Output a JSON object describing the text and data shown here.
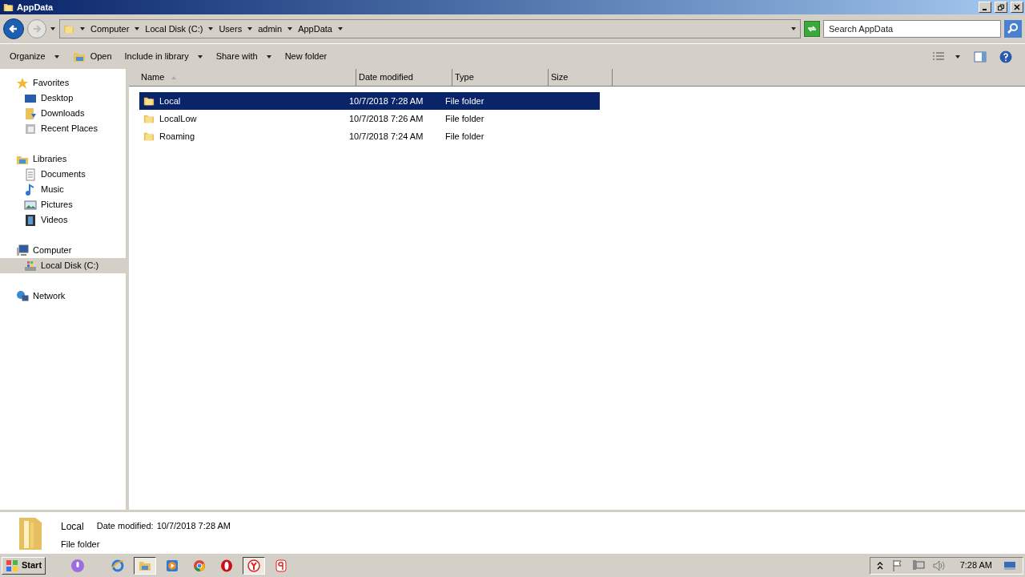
{
  "window": {
    "title": "AppData"
  },
  "address": {
    "crumbs": [
      "Computer",
      "Local Disk (C:)",
      "Users",
      "admin",
      "AppData"
    ],
    "search_placeholder": "Search AppData"
  },
  "toolbar": [
    {
      "label": "Organize",
      "kind": "menu"
    },
    {
      "label": "Open",
      "kind": "open"
    },
    {
      "label": "Include in library",
      "kind": "menu"
    },
    {
      "label": "Share with",
      "kind": "menu"
    },
    {
      "label": "New folder",
      "kind": "plain"
    }
  ],
  "sidebar": [
    {
      "label": "Favorites",
      "kind": "star",
      "selected": false,
      "children": [
        {
          "label": "Desktop",
          "kind": "desktop",
          "selected": false
        },
        {
          "label": "Downloads",
          "kind": "downloads",
          "selected": false
        },
        {
          "label": "Recent Places",
          "kind": "recent",
          "selected": false
        }
      ]
    },
    {
      "label": "Libraries",
      "kind": "library",
      "selected": false,
      "children": [
        {
          "label": "Documents",
          "kind": "document",
          "selected": false
        },
        {
          "label": "Music",
          "kind": "music",
          "selected": false
        },
        {
          "label": "Pictures",
          "kind": "pictures",
          "selected": false
        },
        {
          "label": "Videos",
          "kind": "videos",
          "selected": false
        }
      ]
    },
    {
      "label": "Computer",
      "kind": "computer",
      "selected": false,
      "children": [
        {
          "label": "Local Disk (C:)",
          "kind": "disk",
          "selected": true
        }
      ]
    },
    {
      "label": "Network",
      "kind": "network",
      "selected": false
    }
  ],
  "table": {
    "columns": [
      "Name",
      "Date modified",
      "Type",
      "Size"
    ],
    "rows": [
      {
        "name": "Local",
        "date": "10/7/2018 7:28 AM",
        "type": "File folder",
        "selected": true
      },
      {
        "name": "LocalLow",
        "date": "10/7/2018 7:26 AM",
        "type": "File folder",
        "selected": false
      },
      {
        "name": "Roaming",
        "date": "10/7/2018 7:24 AM",
        "type": "File folder",
        "selected": false
      }
    ]
  },
  "details": {
    "name": "Local",
    "date_label": "Date modified:",
    "date": "10/7/2018 7:28 AM",
    "type": "File folder"
  },
  "taskbar": {
    "start": "Start",
    "apps": [
      {
        "kind": "mic",
        "pressed": false
      },
      {
        "kind": "ie",
        "pressed": false
      },
      {
        "kind": "explorer",
        "pressed": true
      },
      {
        "kind": "media",
        "pressed": false
      },
      {
        "kind": "chrome",
        "pressed": false
      },
      {
        "kind": "opera",
        "pressed": false
      },
      {
        "kind": "yandex",
        "pressed": true
      },
      {
        "kind": "yandex-red",
        "pressed": false
      }
    ],
    "clock": "7:28 AM"
  }
}
